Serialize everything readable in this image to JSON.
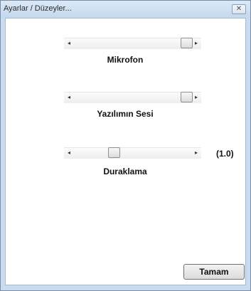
{
  "window": {
    "title": "Ayarlar / Düzeyler...",
    "close_glyph": "✕"
  },
  "sliders": [
    {
      "label": "Mikrofon",
      "level": 0.95,
      "left_arrow": "◂",
      "right_arrow": "▸"
    },
    {
      "label": "Yazılımın Sesi",
      "level": 0.95,
      "left_arrow": "◂",
      "right_arrow": "▸"
    },
    {
      "label": "Duraklama",
      "level": 0.4,
      "value_text": "(1.0)",
      "left_arrow": "◂",
      "right_arrow": "▸"
    }
  ],
  "buttons": {
    "ok_label": "Tamam"
  },
  "colors": {
    "frame": "#c9dcef",
    "client_bg": "#ffffff"
  }
}
